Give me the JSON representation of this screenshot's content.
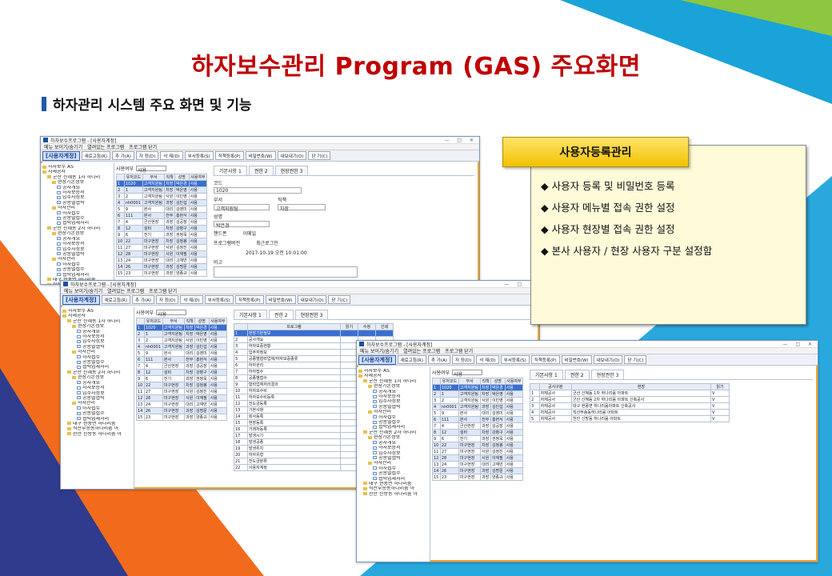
{
  "title": "하자보수관리 Program (GAS) 주요화면",
  "section": "하자관리 시스템 주요 화면 및 기능",
  "panel": {
    "heading": "사용자등록관리",
    "features": [
      "◆ 사용자 등록 및 비밀번호 등록",
      "◆ 사용자 메뉴별 접속 권한 설정",
      "◆ 사용자 현장별 접속 권한 설정",
      "◆  본사 사용자 / 현장 사용자 구분 설정함"
    ]
  },
  "app": {
    "window_title": "하자보수프로그램 - [사용자계정]",
    "menu": [
      "메뉴 보이기/숨기기",
      "열려있는 프로그램",
      "프로그램 닫기"
    ],
    "screen_label": "[사용자계정]",
    "toolbar": [
      "새로고침(R)",
      "추 가(A)",
      "저 장(D)",
      "삭 제(D)",
      "부서등록(S)",
      "직책등록(P)",
      "비밀번호(W)",
      "내보내기(O)",
      "닫 기(C)"
    ],
    "filter_label": "사용여부",
    "filter_value": "사용",
    "columns": [
      "",
      "유저코드",
      "부서",
      "직책",
      "성명",
      "사용여부"
    ],
    "rows": [
      [
        "1",
        "1020",
        "고객지원팀",
        "차장",
        "박은경",
        "사용"
      ],
      [
        "2",
        "1",
        "고객지원팀",
        "차장",
        "박은영",
        "사용"
      ],
      [
        "3",
        "2",
        "고객지원팀",
        "사원",
        "이민영",
        "사용"
      ],
      [
        "4",
        "nh0001",
        "고객지원팀",
        "과장",
        "김민섭",
        "사용"
      ],
      [
        "5",
        "9",
        "본사",
        "대리",
        "김영미",
        "사용"
      ],
      [
        "6",
        "111",
        "본사",
        "전무",
        "홍현식",
        "사용"
      ],
      [
        "7",
        "4",
        "군산현장",
        "과장",
        "김공장",
        "사용"
      ],
      [
        "8",
        "12",
        "설비",
        "차장",
        "강병구",
        "사용"
      ],
      [
        "9",
        "6",
        "전기",
        "과장",
        "권정욱",
        "사용"
      ],
      [
        "10",
        "22",
        "미구현장",
        "차장",
        "김정봉",
        "사용"
      ],
      [
        "11",
        "27",
        "미구현장",
        "사원",
        "김정진",
        "사용"
      ],
      [
        "12",
        "28",
        "미구현장",
        "사원",
        "이재필",
        "사용"
      ],
      [
        "13",
        "24",
        "미구현장",
        "대리",
        "고재만",
        "사용"
      ],
      [
        "14",
        "26",
        "미구현장",
        "과장",
        "김명문",
        "사용"
      ],
      [
        "15",
        "23",
        "미구현장",
        "과장",
        "양종규",
        "사용"
      ]
    ],
    "tree": [
      "하자보수 AS",
      "자체공사",
      "군산 신혜동 1차 하나리",
      "현장기본정보",
      "공사개요",
      "하자보증서",
      "입주자정보",
      "공종별협력",
      "하자관리",
      "하자접수",
      "공종별접수",
      "협력업체처리",
      "군산 신혜동 2차 하나리",
      "현장기본정보",
      "공사개요",
      "하자보증서",
      "입주자정보",
      "공종별협력",
      "하자관리",
      "하자접수",
      "공종별접수",
      "협력업체처리",
      "대구 현풍면 하나리움",
      "직산부송동하나리움 아",
      "천안 신방동 하나리움 아"
    ],
    "tabs": [
      "기본사항 1",
      "권한 2",
      "현장권한 3"
    ],
    "fields": {
      "code_label": "코드",
      "code": "1020",
      "dept_label": "부서",
      "dept": "고객지원팀",
      "pos_label": "직책",
      "pos": "차장",
      "name_label": "성명",
      "name": "박은경",
      "phone_label": "핸드폰",
      "email_label": "이메일",
      "pw_label": "프로그램버전",
      "login_label": "최근로그인",
      "login": "2017-10-19 오전 10:01:00",
      "memo_label": "비고"
    },
    "perm_columns": [
      "",
      "프로그램",
      "읽기",
      "수정",
      "인쇄"
    ],
    "perms": [
      "현장기본정보",
      "공사개요",
      "하자보증현황",
      "입주자정보",
      "공종별협력업체/하자보증종류",
      "하자관리",
      "하자접수",
      "공종별접수",
      "협력업체처리결과",
      "하자보수비",
      "하자보수비등록",
      "전도금등록",
      "기본사항",
      "회사등록",
      "현장등록",
      "거래처등록",
      "발생시기",
      "발생공종",
      "발생위치",
      "하자유형",
      "전도금분류",
      "사용자계정"
    ],
    "site_columns": [
      "",
      "공사구분",
      "현장",
      "읽기"
    ],
    "sites": [
      [
        "1",
        "자체공사",
        "군산 신혜동 1차 하나리움 아파트",
        "V"
      ],
      [
        "2",
        "자체공사",
        "군산 신혜동 2차 하나리움 아파트 신축공사",
        "V"
      ],
      [
        "3",
        "자체공사",
        "대구 현풍면 하나리움아파트 신축공사",
        "V"
      ],
      [
        "4",
        "자체공사",
        "직산부송동하나리움 아파트",
        "V"
      ],
      [
        "5",
        "자체공사",
        "천안 신방동 하나리움 아파트",
        "V"
      ]
    ]
  }
}
